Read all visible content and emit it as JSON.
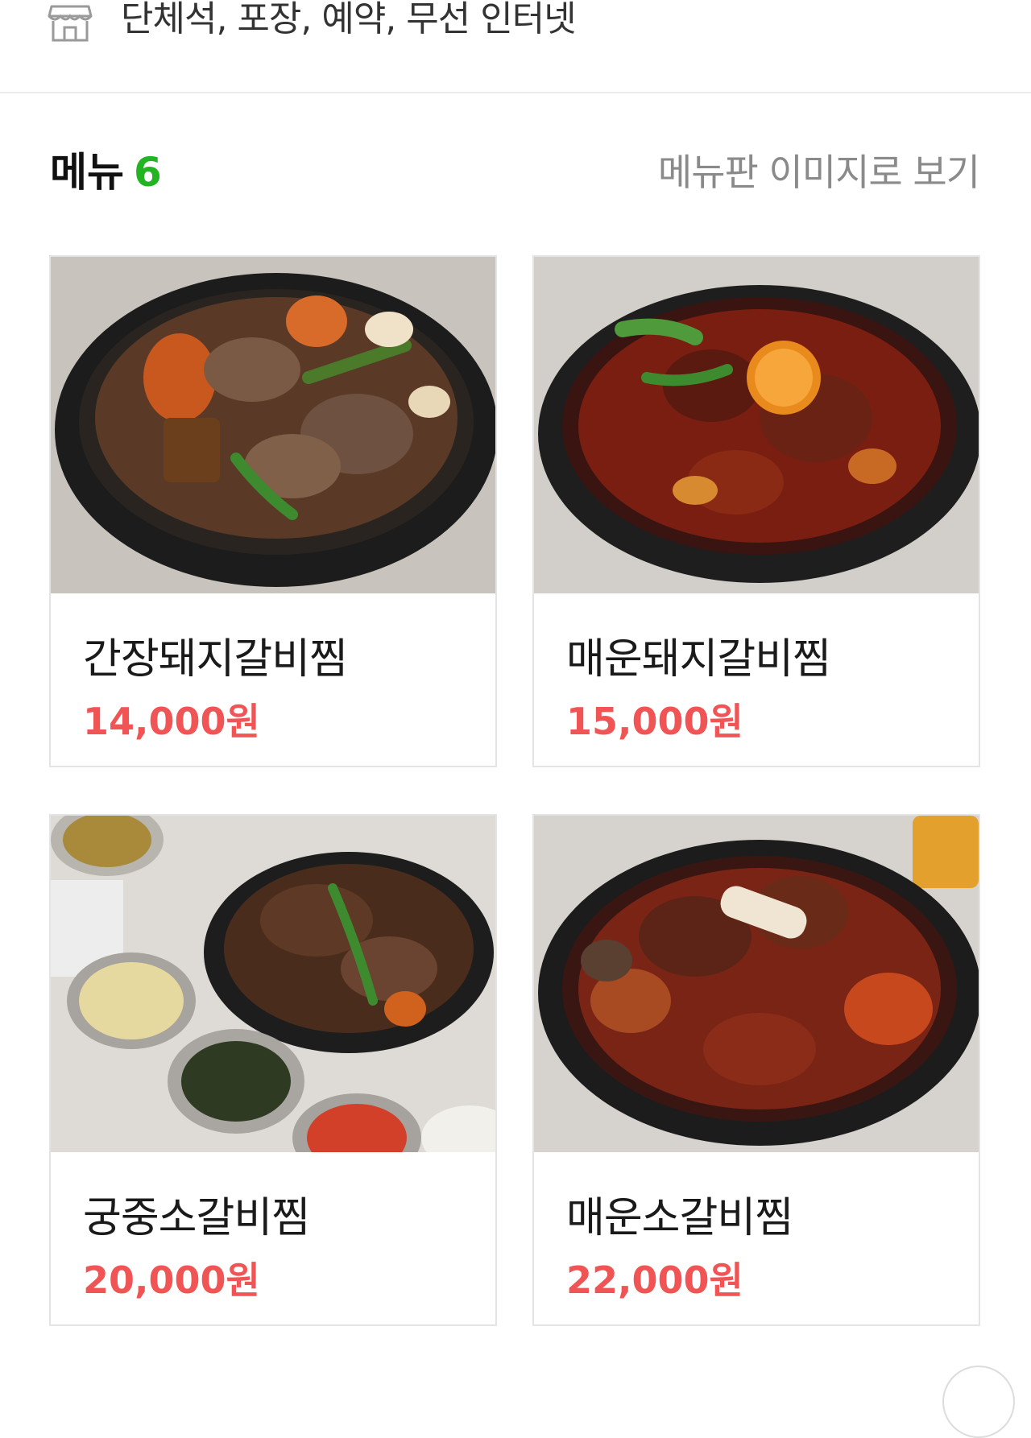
{
  "facilities": {
    "icon": "store-icon",
    "text": "단체석, 포장, 예약, 무선 인터넷"
  },
  "menu_section": {
    "title": "메뉴",
    "count": "6",
    "image_link": "메뉴판 이미지로 보기",
    "count_color": "#22b422"
  },
  "menu_items": [
    {
      "name": "간장돼지갈비찜",
      "price": "14,000원",
      "photo": "braised soy-sauce pork ribs in black bowl"
    },
    {
      "name": "매운돼지갈비찜",
      "price": "15,000원",
      "photo": "spicy braised pork ribs in black bowl"
    },
    {
      "name": "궁중소갈비찜",
      "price": "20,000원",
      "photo": "royal braised beef short ribs with side dishes"
    },
    {
      "name": "매운소갈비찜",
      "price": "22,000원",
      "photo": "spicy braised beef short ribs in black bowl"
    }
  ],
  "colors": {
    "price": "#f05454",
    "accent_green": "#22b422"
  }
}
